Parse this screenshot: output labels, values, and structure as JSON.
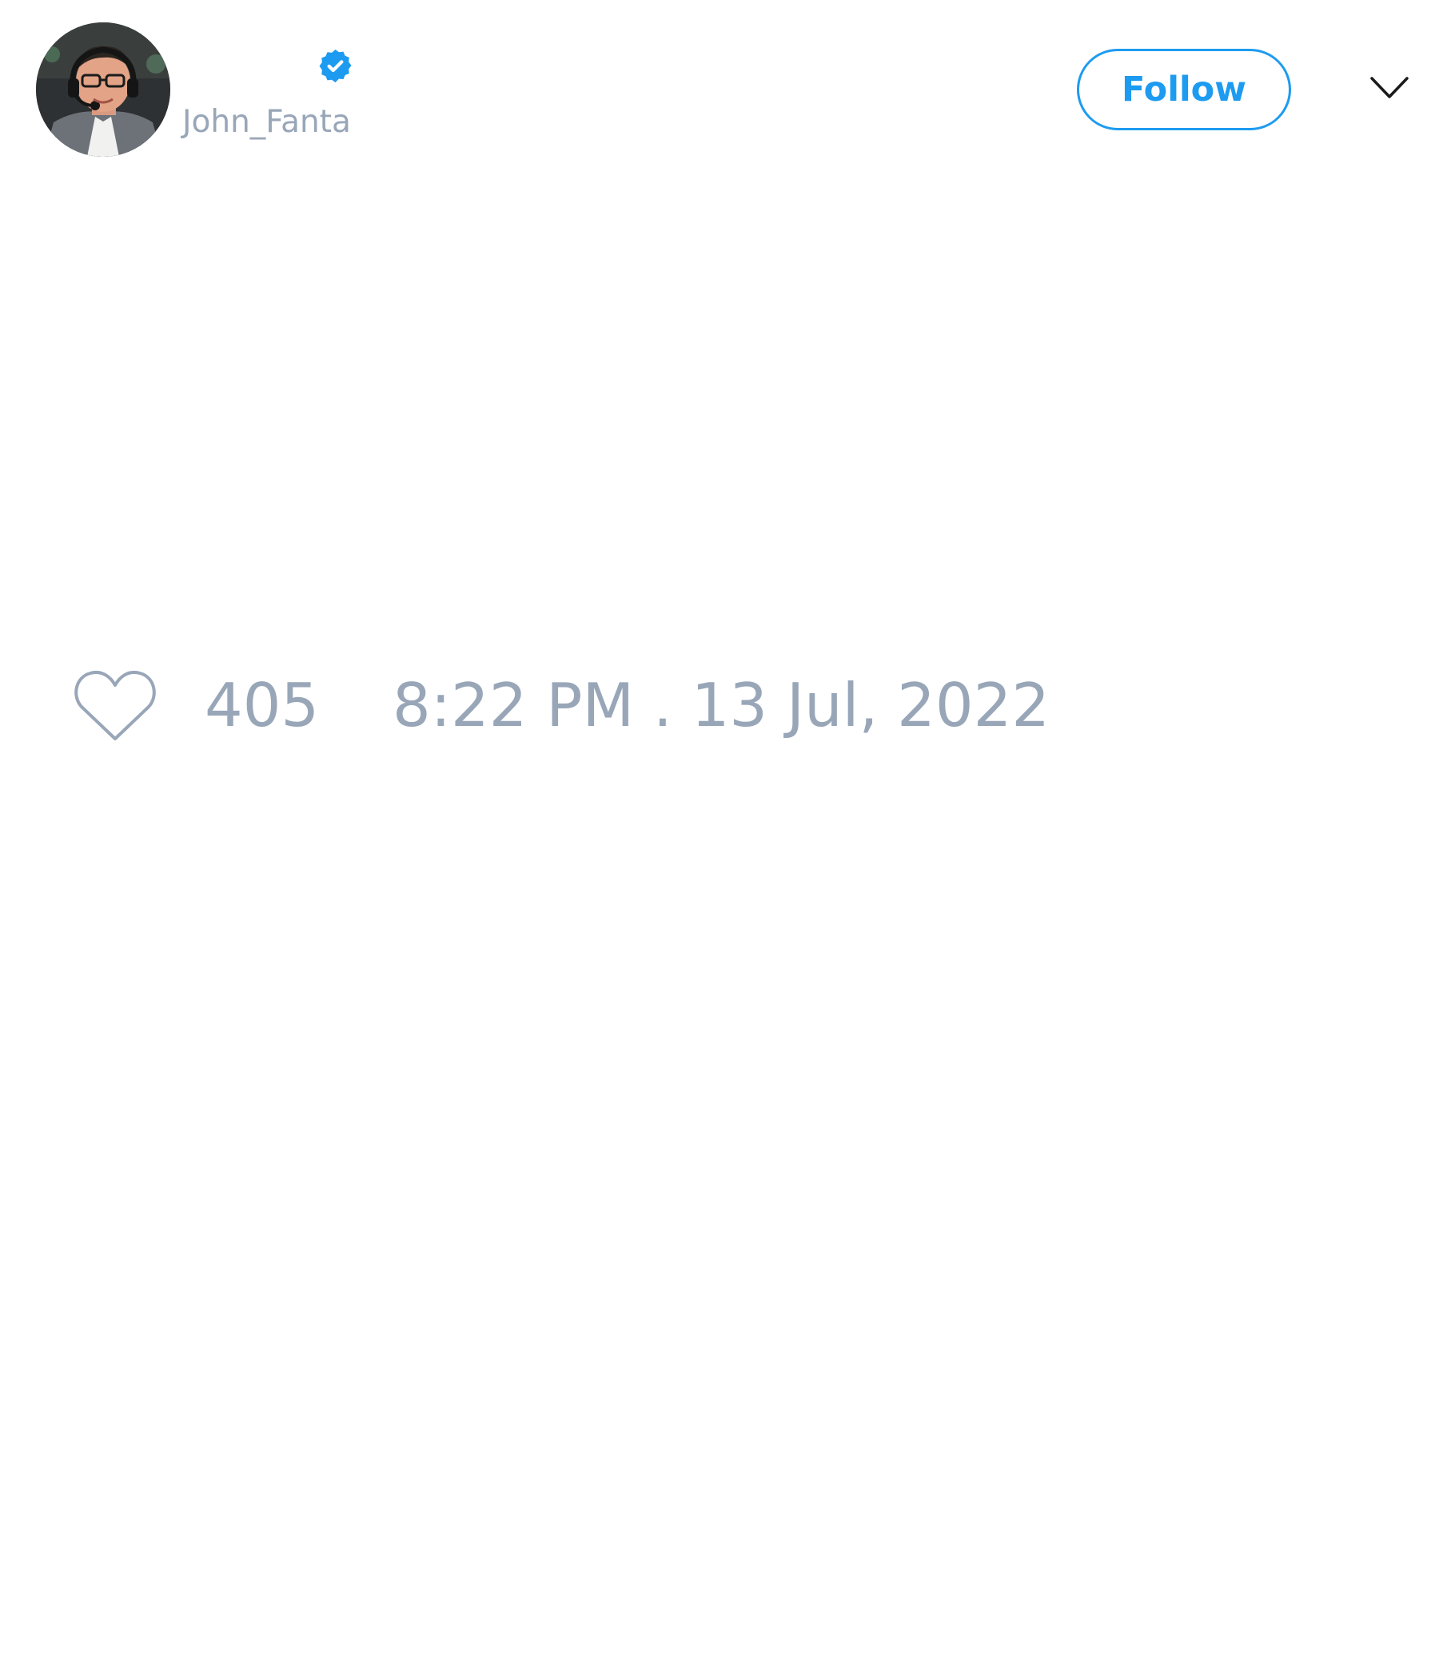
{
  "author": {
    "handle": "John_Fanta",
    "verified": true,
    "avatar_icon": "profile-photo",
    "verified_icon": "verified-badge-icon"
  },
  "header": {
    "follow_label": "Follow",
    "menu_icon": "chevron-down-icon"
  },
  "footer": {
    "like_icon": "heart-icon",
    "like_count": "405",
    "timestamp": "8:22 PM . 13 Jul, 2022"
  },
  "colors": {
    "accent": "#1d9bf0",
    "muted_text": "#98a6b8",
    "background": "#ffffff"
  }
}
